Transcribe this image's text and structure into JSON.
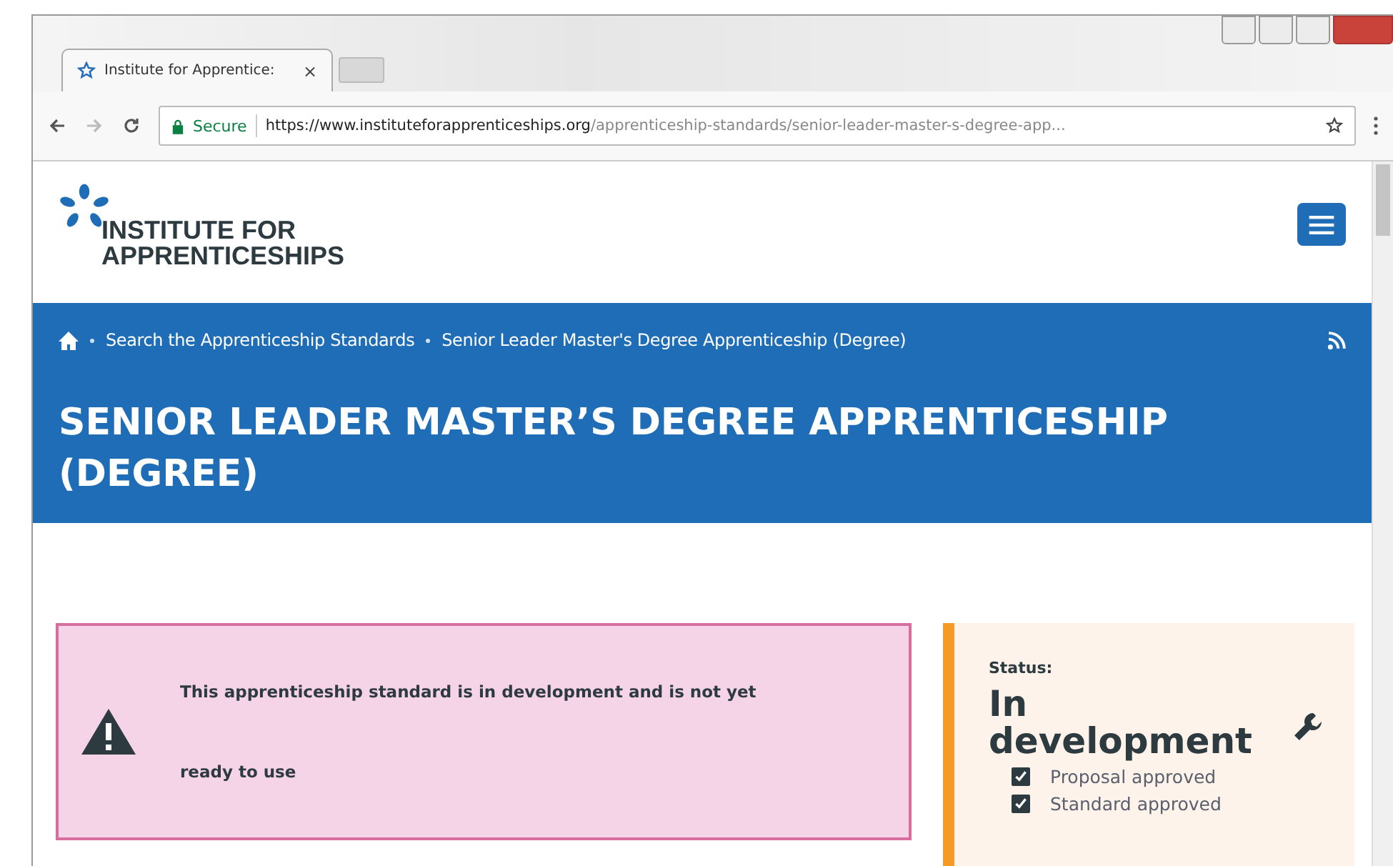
{
  "browser": {
    "tab": {
      "title": "Institute for Apprentice:",
      "close": "×"
    },
    "address": {
      "secure_label": "Secure",
      "url_host": "https://www.instituteforapprenticeships.org",
      "url_path": "/apprenticeship-standards/senior-leader-master-s-degree-app..."
    }
  },
  "site": {
    "logo_lines": [
      "INSTITUTE FOR",
      "APPRENTICESHIPS"
    ]
  },
  "breadcrumb": [
    "Search the Apprenticeship Standards",
    "Senior Leader Master's Degree Apprenticeship (Degree)"
  ],
  "page_title": "SENIOR LEADER MASTER’S DEGREE APPRENTICESHIP (DEGREE)",
  "alert": {
    "lines": [
      "This apprenticeship standard is in development and is not yet",
      "ready to use"
    ]
  },
  "status": {
    "label": "Status:",
    "value": "In development",
    "steps": [
      {
        "label": "Proposal approved",
        "checked": true
      },
      {
        "label": "Standard approved",
        "checked": true
      }
    ]
  }
}
